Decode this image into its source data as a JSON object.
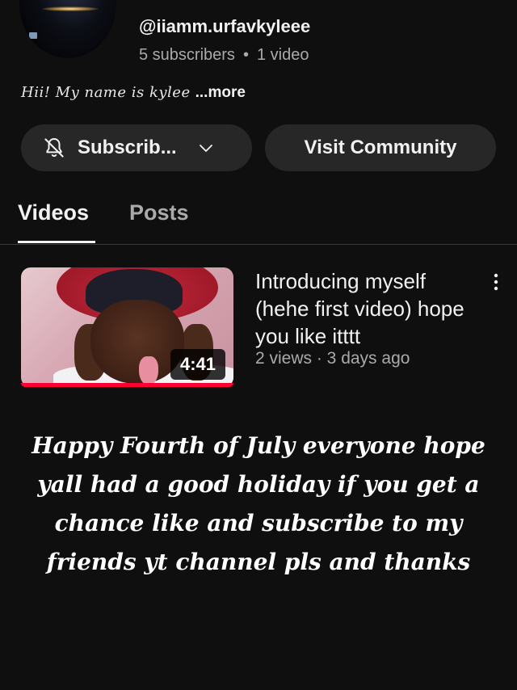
{
  "channel": {
    "name": "",
    "handle": "@iiamm.urfavkyleee",
    "subscribers": "5 subscribers",
    "separator": "•",
    "video_count": "1 video",
    "bio": "Hii! My name is kylee",
    "bio_more": "...more"
  },
  "buttons": {
    "subscribe_label": "Subscrib...",
    "subscribe_icon": "bell-off-icon",
    "dropdown_icon": "chevron-down-icon",
    "visit_community_label": "Visit Community"
  },
  "tabs": [
    {
      "label": "Videos",
      "active": true
    },
    {
      "label": "Posts",
      "active": false
    }
  ],
  "videos": [
    {
      "title": "Introducing myself (hehe first video) hope you like itttt",
      "meta": "2 views · 3 days ago",
      "duration": "4:41",
      "watched_fraction": 1.0,
      "menu_icon": "more-vert-icon"
    }
  ],
  "overlay_caption": "Happy Fourth of July everyone hope yall had a good holiday if you get a chance like and subscribe to my friends yt channel pls and thanks",
  "colors": {
    "background": "#0f0f0f",
    "button_bg": "#272727",
    "secondary_text": "#aaaaaa",
    "progress_red": "#ff0033"
  }
}
